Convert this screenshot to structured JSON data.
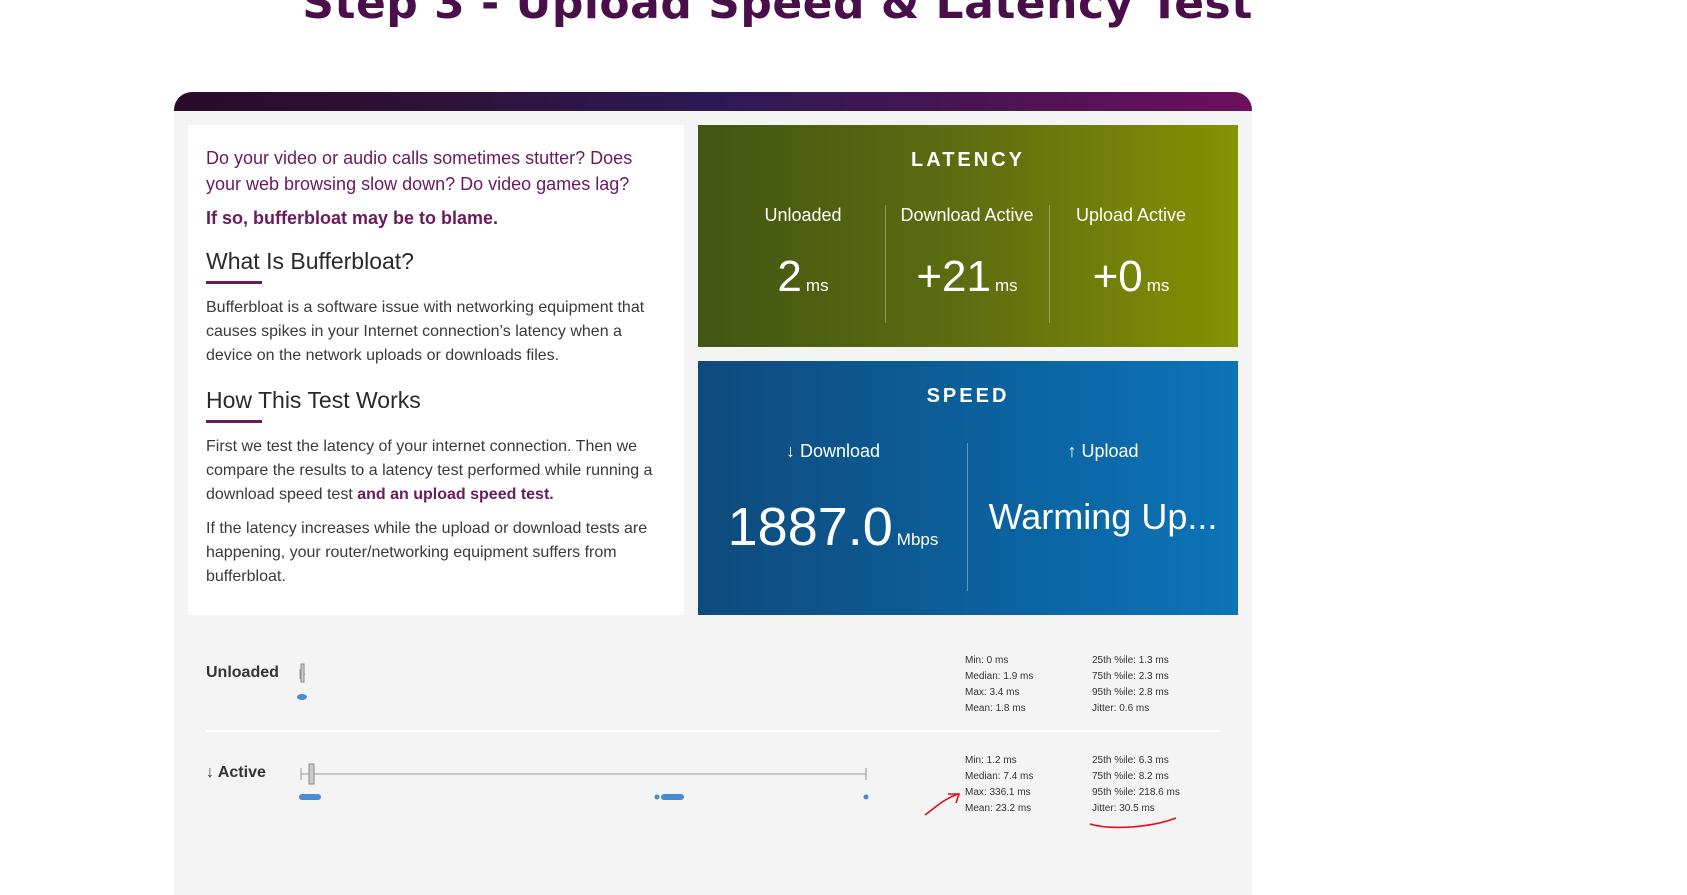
{
  "title": "Step 3 - Upload Speed & Latency Test",
  "info": {
    "intro": "Do your video or audio calls sometimes stutter? Does your web browsing slow down? Do video games lag?",
    "blame": "If so, bufferbloat may be to blame.",
    "what_heading": "What Is Bufferbloat?",
    "what_text": "Bufferbloat is a software issue with networking equipment that causes spikes in your Internet connection’s latency when a device on the network uploads or downloads files.",
    "how_heading": "How This Test Works",
    "how_text_a": "First we test the latency of your internet connection. Then we compare the results to a latency test performed while running a download speed test",
    "how_text_b": "and an upload speed test.",
    "how_text_c": "If the latency increases while the upload or download tests are happening, your router/networking equipment suffers from bufferbloat."
  },
  "latency": {
    "title": "LATENCY",
    "columns": [
      {
        "label": "Unloaded",
        "value": "2",
        "unit": "ms"
      },
      {
        "label": "Download Active",
        "value": "+21",
        "unit": "ms"
      },
      {
        "label": "Upload Active",
        "value": "+0",
        "unit": "ms"
      }
    ]
  },
  "speed": {
    "title": "SPEED",
    "download_label": "↓ Download",
    "download_value": "1887.0",
    "download_unit": "Mbps",
    "upload_label": "↑ Upload",
    "upload_value": "Warming Up..."
  },
  "rows": {
    "unloaded": {
      "label": "Unloaded",
      "stats_left": [
        "Min: 0 ms",
        "Median: 1.9 ms",
        "Max: 3.4 ms",
        "Mean: 1.8 ms"
      ],
      "stats_right": [
        "25th %ile: 1.3 ms",
        "75th %ile: 2.3 ms",
        "95th %ile: 2.8 ms",
        "Jitter: 0.6 ms"
      ]
    },
    "active": {
      "label": "↓ Active",
      "stats_left": [
        "Min: 1.2 ms",
        "Median: 7.4 ms",
        "Max: 336.1 ms",
        "Mean: 23.2 ms"
      ],
      "stats_right": [
        "25th %ile: 6.3 ms",
        "75th %ile: 8.2 ms",
        "95th %ile: 218.6 ms",
        "Jitter: 30.5 ms"
      ]
    }
  },
  "colors": {
    "accent": "#6a1a5e",
    "latency_start": "#425512",
    "latency_end": "#849203",
    "speed_start": "#0f4a7c",
    "speed_end": "#0c74b8",
    "dot": "#4a8bd6",
    "annotation": "#e0101a"
  }
}
